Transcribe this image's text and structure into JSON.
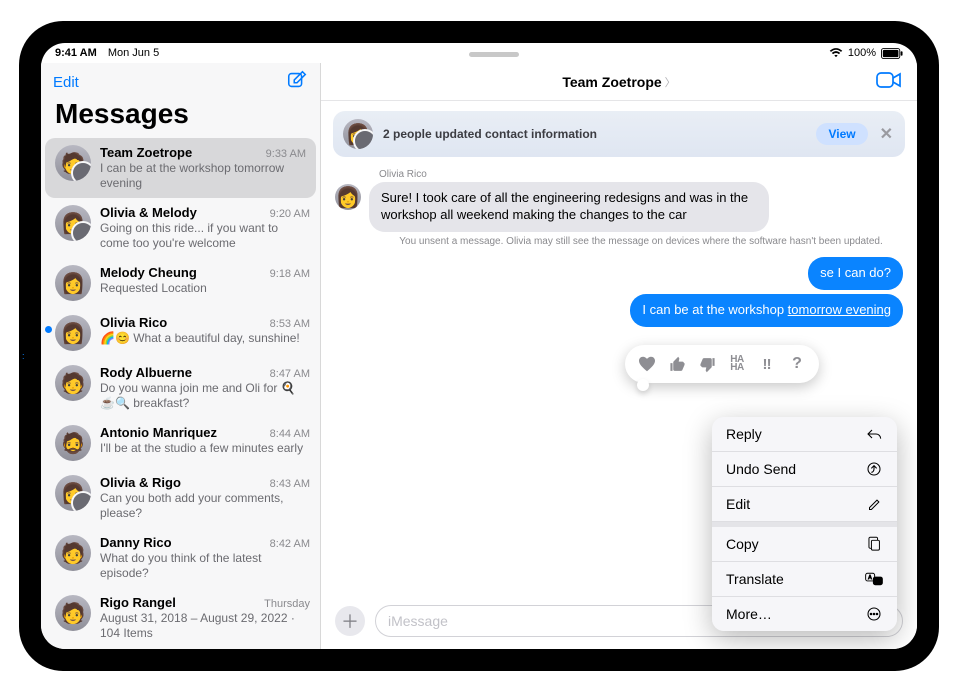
{
  "status": {
    "time": "9:41 AM",
    "date": "Mon Jun 5",
    "battery_text": "100%"
  },
  "sidebar": {
    "edit_label": "Edit",
    "title": "Messages",
    "items": [
      {
        "name": "Team Zoetrope",
        "time": "9:33 AM",
        "preview": "I can be at the workshop tomorrow evening",
        "group": true,
        "selected": true
      },
      {
        "name": "Olivia & Melody",
        "time": "9:20 AM",
        "preview": "Going on this ride... if you want to come too you're welcome",
        "group": true
      },
      {
        "name": "Melody Cheung",
        "time": "9:18 AM",
        "preview": "Requested Location"
      },
      {
        "name": "Olivia Rico",
        "time": "8:53 AM",
        "preview": "🌈😊 What a beautiful day, sunshine!",
        "unread": true
      },
      {
        "name": "Rody Albuerne",
        "time": "8:47 AM",
        "preview": "Do you wanna join me and Oli for 🍳☕🔍 breakfast?"
      },
      {
        "name": "Antonio Manriquez",
        "time": "8:44 AM",
        "preview": "I'll be at the studio a few minutes early"
      },
      {
        "name": "Olivia & Rigo",
        "time": "8:43 AM",
        "preview": "Can you both add your comments, please?",
        "group": true
      },
      {
        "name": "Danny Rico",
        "time": "8:42 AM",
        "preview": "What do you think of the latest episode?"
      },
      {
        "name": "Rigo Rangel",
        "time": "Thursday",
        "preview": "August 31, 2018 – August 29, 2022 · 104 Items"
      }
    ]
  },
  "conversation": {
    "title": "Team Zoetrope",
    "banner_text": "2 people updated contact information",
    "banner_view": "View",
    "sender": "Olivia Rico",
    "incoming": "Sure! I took care of all the engineering redesigns and was in the workshop all weekend making the changes to the car",
    "unsend_note": "You unsent a message. Olivia may still see the message on devices where the software hasn't been updated.",
    "outgoing_partial": "se I can do?",
    "outgoing_main_pre": "I can be at the workshop ",
    "outgoing_main_link": "tomorrow evening",
    "compose_placeholder": "iMessage"
  },
  "context_menu": {
    "reply": "Reply",
    "undo_send": "Undo Send",
    "edit": "Edit",
    "copy": "Copy",
    "translate": "Translate",
    "more": "More…"
  }
}
